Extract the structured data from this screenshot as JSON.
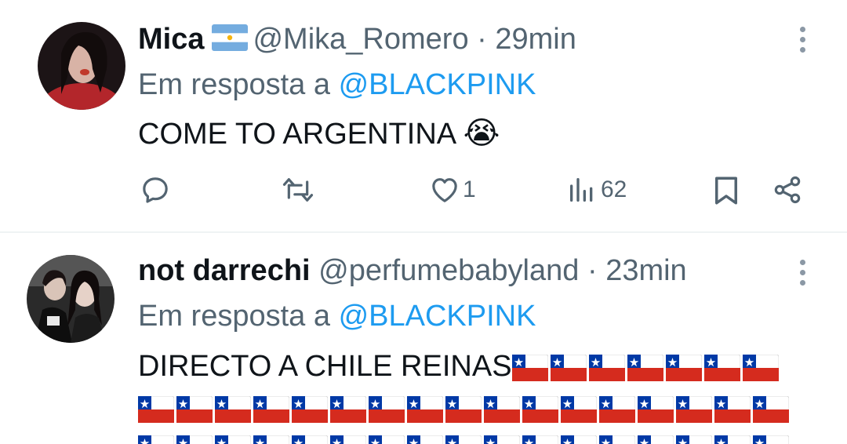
{
  "tweets": [
    {
      "display_name": "Mica",
      "name_flag": "argentina-flag-emoji",
      "handle": "@Mika_Romero",
      "separator": "·",
      "time": "29min",
      "reply_prefix": "Em resposta a",
      "reply_to": "@BLACKPINK",
      "text": "COME TO  ARGENTINA",
      "text_emoji": "😭",
      "likes": "1",
      "views": "62"
    },
    {
      "display_name": "not darrechi",
      "handle": "@perfumebabyland",
      "separator": "·",
      "time": "23min",
      "reply_prefix": "Em resposta a",
      "reply_to": "@BLACKPINK",
      "text": "DIRECTO A CHILE REINAS",
      "text_emoji": "chile-flag-emoji"
    }
  ],
  "colors": {
    "text": "#0f1419",
    "secondary": "#536471",
    "link": "#1d9bf0",
    "divider": "#eff3f4"
  }
}
